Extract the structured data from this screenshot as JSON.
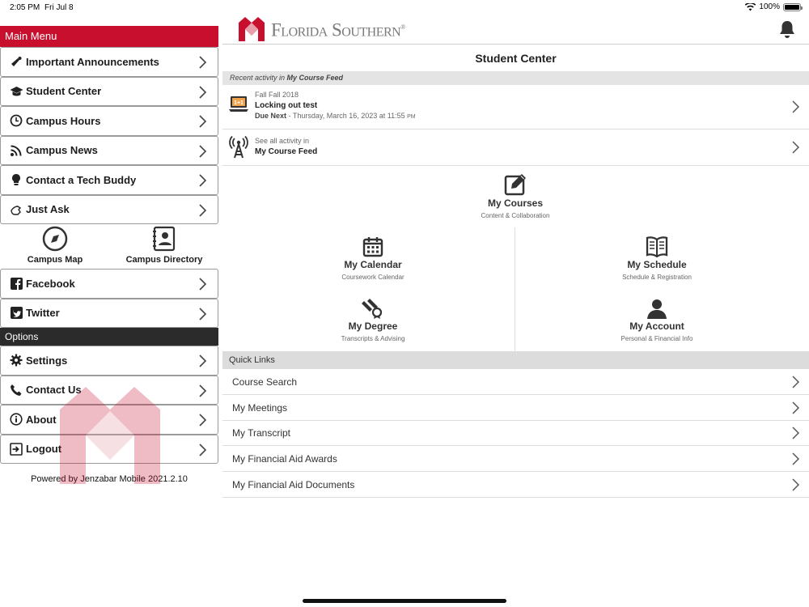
{
  "status": {
    "time": "2:05 PM",
    "date": "Fri Jul 8",
    "battery": "100%"
  },
  "sidebar": {
    "main_menu_title": "Main Menu",
    "items": [
      {
        "label": "Important Announcements",
        "icon": "megaphone-icon"
      },
      {
        "label": "Student Center",
        "icon": "graduation-cap-icon"
      },
      {
        "label": "Campus Hours",
        "icon": "clock-icon"
      },
      {
        "label": "Campus News",
        "icon": "rss-icon"
      },
      {
        "label": "Contact a Tech Buddy",
        "icon": "lightbulb-icon"
      },
      {
        "label": "Just Ask",
        "icon": "hand-icon"
      }
    ],
    "grid": [
      {
        "label": "Campus Map",
        "icon": "compass-icon"
      },
      {
        "label": "Campus Directory",
        "icon": "address-book-icon"
      }
    ],
    "social": [
      {
        "label": "Facebook",
        "icon": "facebook-icon"
      },
      {
        "label": "Twitter",
        "icon": "twitter-icon"
      }
    ],
    "options_title": "Options",
    "options": [
      {
        "label": "Settings",
        "icon": "gear-icon"
      },
      {
        "label": "Contact Us",
        "icon": "phone-icon"
      },
      {
        "label": "About",
        "icon": "info-icon"
      },
      {
        "label": "Logout",
        "icon": "logout-icon"
      }
    ],
    "powered_by": "Powered by Jenzabar Mobile 2021.2.10"
  },
  "header": {
    "logo_text": "Florida Southern",
    "logo_reg": "®"
  },
  "main": {
    "title": "Student Center",
    "feed_header_prefix": "Recent activity in ",
    "feed_header_name": "My Course Feed",
    "feed_item": {
      "term": "Fall Fall 2018",
      "title": "Locking out test",
      "due_label": "Due Next",
      "due_text": " - Thursday, March 16, 2023 at 11:55 ",
      "due_ampm": "PM"
    },
    "see_all": {
      "line1": "See all activity in",
      "line2": "My Course Feed"
    },
    "tiles": [
      {
        "title": "My Courses",
        "subtitle": "Content & Collaboration"
      },
      {
        "title": "My Calendar",
        "subtitle": "Coursework Calendar"
      },
      {
        "title": "My Schedule",
        "subtitle": "Schedule & Registration"
      },
      {
        "title": "My Degree",
        "subtitle": "Transcripts & Advising"
      },
      {
        "title": "My Account",
        "subtitle": "Personal & Financial Info"
      }
    ],
    "quick_links_title": "Quick Links",
    "quick_links": [
      "Course Search",
      "My Meetings",
      "My Transcript",
      "My Financial Aid Awards",
      "My Financial Aid Documents"
    ]
  },
  "colors": {
    "brand_red": "#c8102e",
    "dark_header": "#2b2b2b"
  }
}
